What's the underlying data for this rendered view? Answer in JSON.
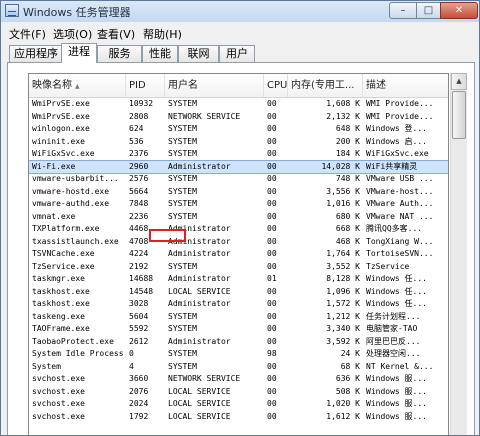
{
  "window": {
    "title": "Windows 任务管理器",
    "min_label": "–",
    "max_label": "□",
    "close_label": "✕"
  },
  "menu": [
    {
      "label": "文件(F)"
    },
    {
      "label": "选项(O)"
    },
    {
      "label": "查看(V)"
    },
    {
      "label": "帮助(H)"
    }
  ],
  "tabs": [
    {
      "label": "应用程序",
      "active": false
    },
    {
      "label": "进程",
      "active": true
    },
    {
      "label": "服务",
      "active": false
    },
    {
      "label": "性能",
      "active": false
    },
    {
      "label": "联网",
      "active": false
    },
    {
      "label": "用户",
      "active": false
    }
  ],
  "columns": {
    "name": "映像名称",
    "pid": "PID",
    "user": "用户名",
    "cpu": "CPU",
    "mem": "内存(专用工...",
    "desc": "描述"
  },
  "processes": [
    {
      "name": "WmiPrvSE.exe",
      "pid": "10932",
      "user": "SYSTEM",
      "cpu": "00",
      "mem": "1,608 K",
      "desc": "WMI Provide..."
    },
    {
      "name": "WmiPrvSE.exe",
      "pid": "2808",
      "user": "NETWORK SERVICE",
      "cpu": "00",
      "mem": "2,132 K",
      "desc": "WMI Provide..."
    },
    {
      "name": "winlogon.exe",
      "pid": "624",
      "user": "SYSTEM",
      "cpu": "00",
      "mem": "648 K",
      "desc": "Windows 登..."
    },
    {
      "name": "wininit.exe",
      "pid": "536",
      "user": "SYSTEM",
      "cpu": "00",
      "mem": "200 K",
      "desc": "Windows 启..."
    },
    {
      "name": "WiFiGxSvc.exe",
      "pid": "2376",
      "user": "SYSTEM",
      "cpu": "00",
      "mem": "184 K",
      "desc": "WiFiGxSvc.exe"
    },
    {
      "name": "Wi-Fi.exe",
      "pid": "2960",
      "user": "Administrator",
      "cpu": "00",
      "mem": "14,028 K",
      "desc": "WiFi共享精灵",
      "selected": true
    },
    {
      "name": "vmware-usbarbit...",
      "pid": "2576",
      "user": "SYSTEM",
      "cpu": "00",
      "mem": "748 K",
      "desc": "VMware USB ..."
    },
    {
      "name": "vmware-hostd.exe",
      "pid": "5664",
      "user": "SYSTEM",
      "cpu": "00",
      "mem": "3,556 K",
      "desc": "VMware-host..."
    },
    {
      "name": "vmware-authd.exe",
      "pid": "7848",
      "user": "SYSTEM",
      "cpu": "00",
      "mem": "1,016 K",
      "desc": "VMware Auth..."
    },
    {
      "name": "vmnat.exe",
      "pid": "2236",
      "user": "SYSTEM",
      "cpu": "00",
      "mem": "680 K",
      "desc": "VMware NAT ..."
    },
    {
      "name": "TXPlatform.exe",
      "pid": "4468",
      "user": "Administrator",
      "cpu": "00",
      "mem": "668 K",
      "desc": "腾讯QQ多客..."
    },
    {
      "name": "txassistlaunch.exe",
      "pid": "4708",
      "user": "Administrator",
      "cpu": "00",
      "mem": "468 K",
      "desc": "TongXiang W..."
    },
    {
      "name": "TSVNCache.exe",
      "pid": "4224",
      "user": "Administrator",
      "cpu": "00",
      "mem": "1,764 K",
      "desc": "TortoiseSVN..."
    },
    {
      "name": "TzService.exe",
      "pid": "2192",
      "user": "SYSTEM",
      "cpu": "00",
      "mem": "3,552 K",
      "desc": "TzService"
    },
    {
      "name": "taskmgr.exe",
      "pid": "14688",
      "user": "Administrator",
      "cpu": "01",
      "mem": "8,128 K",
      "desc": "Windows 任..."
    },
    {
      "name": "taskhost.exe",
      "pid": "14548",
      "user": "LOCAL SERVICE",
      "cpu": "00",
      "mem": "1,096 K",
      "desc": "Windows 任..."
    },
    {
      "name": "taskhost.exe",
      "pid": "3028",
      "user": "Administrator",
      "cpu": "00",
      "mem": "1,572 K",
      "desc": "Windows 任..."
    },
    {
      "name": "taskeng.exe",
      "pid": "5604",
      "user": "SYSTEM",
      "cpu": "00",
      "mem": "1,212 K",
      "desc": "任务计划程..."
    },
    {
      "name": "TAOFrame.exe",
      "pid": "5592",
      "user": "SYSTEM",
      "cpu": "00",
      "mem": "3,340 K",
      "desc": "电脑管家-TAO"
    },
    {
      "name": "TaobaoProtect.exe",
      "pid": "2612",
      "user": "Administrator",
      "cpu": "00",
      "mem": "3,592 K",
      "desc": "阿里巴巴反..."
    },
    {
      "name": "System Idle Process",
      "pid": "0",
      "user": "SYSTEM",
      "cpu": "98",
      "mem": "24 K",
      "desc": "处理器空闲..."
    },
    {
      "name": "System",
      "pid": "4",
      "user": "SYSTEM",
      "cpu": "00",
      "mem": "68 K",
      "desc": "NT Kernel &..."
    },
    {
      "name": "svchost.exe",
      "pid": "3660",
      "user": "NETWORK SERVICE",
      "cpu": "00",
      "mem": "636 K",
      "desc": "Windows 服..."
    },
    {
      "name": "svchost.exe",
      "pid": "2076",
      "user": "LOCAL SERVICE",
      "cpu": "00",
      "mem": "508 K",
      "desc": "Windows 服..."
    },
    {
      "name": "svchost.exe",
      "pid": "2024",
      "user": "LOCAL SERVICE",
      "cpu": "00",
      "mem": "1,020 K",
      "desc": "Windows 服..."
    },
    {
      "name": "svchost.exe",
      "pid": "1792",
      "user": "LOCAL SERVICE",
      "cpu": "00",
      "mem": "1,612 K",
      "desc": "Windows 服..."
    }
  ],
  "colors": {
    "selection_bg": "#cfe4fa",
    "highlight_box": "#e02020",
    "title_bg": "#c5d9ef"
  },
  "icons": {
    "app": "task-manager-icon",
    "scroll_up": "arrow-up-icon",
    "sort": "sort-ascending-icon"
  }
}
